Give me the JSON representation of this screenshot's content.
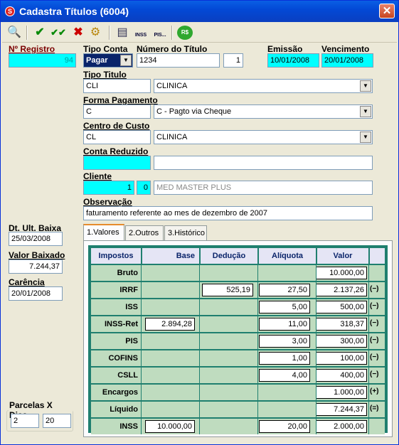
{
  "window": {
    "title": "Cadastra Títulos (6004)",
    "close": "✕"
  },
  "toolbar": {
    "search": "🔍",
    "confirm": "✔",
    "confirm_all": "✔✔",
    "cancel": "✖",
    "tool": "⚙",
    "btn_a": "▤",
    "inss": "INSS",
    "pis": "PIS...",
    "rs": "R$"
  },
  "form": {
    "nregistro_label": "Nº Registro",
    "nregistro_value": "94",
    "tipo_conta_label": "Tipo Conta",
    "tipo_conta_value": "Pagar",
    "numero_titulo_label": "Número do Título",
    "numero_titulo_value": "1234",
    "numero_parcela": "1",
    "emissao_label": "Emissão",
    "emissao_value": "10/01/2008",
    "vencimento_label": "Vencimento",
    "vencimento_value": "20/01/2008",
    "tipo_titulo_label": "Tipo Titulo",
    "tipo_titulo_code": "CLI",
    "tipo_titulo_desc": "CLINICA",
    "forma_pagamento_label": "Forma Pagamento",
    "forma_pagamento_code": "C",
    "forma_pagamento_desc": "C - Pagto via Cheque",
    "centro_custo_label": "Centro de Custo",
    "centro_custo_code": "CL",
    "centro_custo_desc": "CLINICA",
    "conta_reduzido_label": "Conta Reduzido",
    "conta_reduzido_code": "",
    "conta_reduzido_desc": "",
    "cliente_label": "Cliente",
    "cliente_code": "1",
    "cliente_sub": "0",
    "cliente_name": "MED MASTER PLUS",
    "observacao_label": "Observação",
    "observacao_value": "faturamento referente ao mes de dezembro de 2007",
    "dt_ult_baixa_label": "Dt. Ult. Baixa",
    "dt_ult_baixa_value": "25/03/2008",
    "valor_baixado_label": "Valor Baixado",
    "valor_baixado_value": "7.244,37",
    "carencia_label": "Carência",
    "carencia_value": "20/01/2008",
    "parcelas_label": "Parcelas X Dias",
    "parcelas_value": "2",
    "dias_value": "20"
  },
  "tabs": [
    {
      "label": "1.Valores"
    },
    {
      "label": "2.Outros"
    },
    {
      "label": "3.Histórico"
    }
  ],
  "grid": {
    "headers": [
      "Impostos",
      "Base",
      "Dedução",
      "Alíquota",
      "Valor"
    ],
    "rows": [
      {
        "label": "Bruto",
        "base": "",
        "deducao": "",
        "aliquota": "",
        "valor": "10.000,00",
        "sign": ""
      },
      {
        "label": "IRRF",
        "base": "",
        "deducao": "525,19",
        "aliquota": "27,50",
        "valor": "2.137,26",
        "sign": "(−)"
      },
      {
        "label": "ISS",
        "base": "",
        "deducao": "",
        "aliquota": "5,00",
        "valor": "500,00",
        "sign": "(−)"
      },
      {
        "label": "INSS-Ret",
        "base": "2.894,28",
        "deducao": "",
        "aliquota": "11,00",
        "valor": "318,37",
        "sign": "(−)"
      },
      {
        "label": "PIS",
        "base": "",
        "deducao": "",
        "aliquota": "3,00",
        "valor": "300,00",
        "sign": "(−)"
      },
      {
        "label": "COFINS",
        "base": "",
        "deducao": "",
        "aliquota": "1,00",
        "valor": "100,00",
        "sign": "(−)"
      },
      {
        "label": "CSLL",
        "base": "",
        "deducao": "",
        "aliquota": "4,00",
        "valor": "400,00",
        "sign": "(−)"
      },
      {
        "label": "Encargos",
        "base": "",
        "deducao": "",
        "aliquota": "",
        "valor": "1.000,00",
        "sign": "(+)"
      },
      {
        "label": "Líquido",
        "base": "",
        "deducao": "",
        "aliquota": "",
        "valor": "7.244,37",
        "sign": "(=)"
      },
      {
        "label": "INSS",
        "base": "10.000,00",
        "deducao": "",
        "aliquota": "20,00",
        "valor": "2.000,00",
        "sign": ""
      }
    ]
  },
  "colors": {
    "title_bar": "#0a5fe4",
    "accent_cyan": "#00ffff",
    "grid_border": "#1f7f6f",
    "grid_bg": "#bfdcbf"
  }
}
